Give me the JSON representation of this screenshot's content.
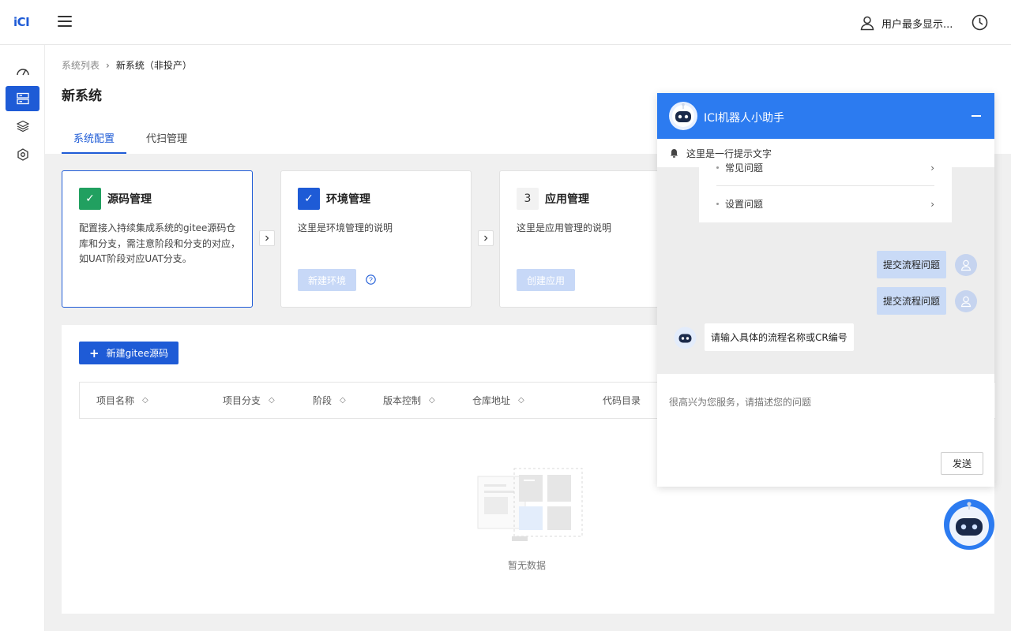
{
  "app": {
    "logo": "iCI"
  },
  "header": {
    "user_name": "用户最多显示..."
  },
  "breadcrumb": {
    "parent": "系统列表",
    "separator": "›",
    "current": "新系统（非投产）"
  },
  "page": {
    "title": "新系统"
  },
  "tabs": [
    {
      "label": "系统配置",
      "active": true
    },
    {
      "label": "代扫管理",
      "active": false
    }
  ],
  "steps": [
    {
      "badge": "✓",
      "title": "源码管理",
      "desc": "配置接入持续集成系统的gitee源码仓库和分支，需注意阶段和分支的对应，如UAT阶段对应UAT分支。"
    },
    {
      "badge": "✓",
      "title": "环境管理",
      "desc": "这里是环境管理的说明",
      "button": "新建环境"
    },
    {
      "badge": "3",
      "title": "应用管理",
      "desc": "这里是应用管理的说明",
      "button": "创建应用"
    }
  ],
  "table": {
    "add_button": "新建gitee源码",
    "columns": [
      "项目名称",
      "项目分支",
      "阶段",
      "版本控制",
      "仓库地址",
      "代码目录"
    ],
    "empty_text": "暂无数据"
  },
  "chat": {
    "title": "ICI机器人小助手",
    "notice": "这里是一行提示文字",
    "faq": [
      "常见问题",
      "设置问题"
    ],
    "user_messages": [
      "提交流程问题",
      "提交流程问题"
    ],
    "bot_message": "请输入具体的流程名称或CR编号",
    "input_placeholder": "很高兴为您服务，请描述您的问题",
    "send_label": "发送"
  },
  "colors": {
    "primary": "#1e5bd6",
    "chat_header": "#2c7bf0",
    "success": "#21a060"
  }
}
